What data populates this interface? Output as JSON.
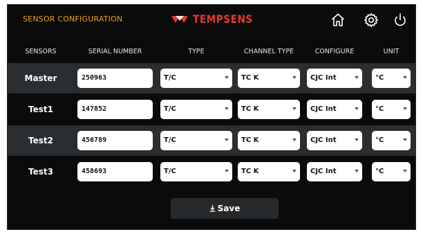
{
  "header": {
    "title": "SENSOR CONFIGURATION",
    "brand": "TEMPSENS",
    "icons": [
      "home-icon",
      "gear-icon",
      "power-icon"
    ],
    "accent": "#e8a21a",
    "brand_color": "#e23a2e"
  },
  "columns": [
    "SENSORS",
    "SERIAL NUMBER",
    "TYPE",
    "CHANNEL TYPE",
    "CONFIGURE",
    "UNIT"
  ],
  "rows": [
    {
      "sensor": "Master",
      "serial": "250963",
      "type": "T/C",
      "channel_type": "TC K",
      "configure": "CJC Int",
      "unit": "°C"
    },
    {
      "sensor": "Test1",
      "serial": "147852",
      "type": "T/C",
      "channel_type": "TC K",
      "configure": "CJC Int",
      "unit": "°C"
    },
    {
      "sensor": "Test2",
      "serial": "456789",
      "type": "T/C",
      "channel_type": "TC K",
      "configure": "CJC Int",
      "unit": "°C"
    },
    {
      "sensor": "Test3",
      "serial": "458693",
      "type": "T/C",
      "channel_type": "TC K",
      "configure": "CJC Int",
      "unit": "°C"
    }
  ],
  "save": {
    "label": "Save",
    "icon": "download-icon"
  }
}
